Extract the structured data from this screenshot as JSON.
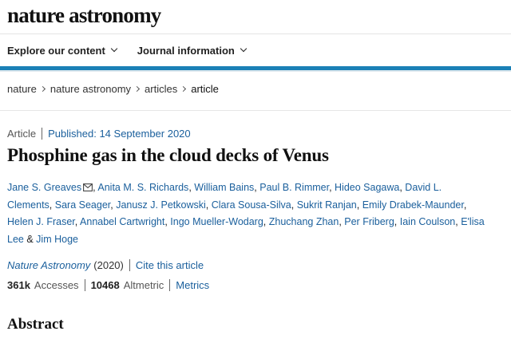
{
  "header": {
    "brand": "nature astronomy"
  },
  "nav": {
    "items": [
      {
        "label": "Explore our content"
      },
      {
        "label": "Journal information"
      }
    ]
  },
  "breadcrumb": [
    "nature",
    "nature astronomy",
    "articles",
    "article"
  ],
  "article": {
    "type": "Article",
    "published": "Published: 14 September 2020",
    "title": "Phosphine gas in the cloud decks of Venus",
    "authors": [
      "Jane S. Greaves",
      "Anita M. S. Richards",
      "William Bains",
      "Paul B. Rimmer",
      "Hideo Sagawa",
      "David L. Clements",
      "Sara Seager",
      "Janusz J. Petkowski",
      "Clara Sousa-Silva",
      "Sukrit Ranjan",
      "Emily Drabek-Maunder",
      "Helen J. Fraser",
      "Annabel Cartwright",
      "Ingo Mueller-Wodarg",
      "Zhuchang Zhan",
      "Per Friberg",
      "Iain Coulson",
      "E'lisa Lee",
      "Jim Hoge"
    ],
    "author_conjunction": "&",
    "journal": "Nature Astronomy",
    "year": "(2020)",
    "cite_label": "Cite this article",
    "accesses_value": "361k",
    "accesses_label": "Accesses",
    "altmetric_value": "10468",
    "altmetric_label": "Altmetric",
    "metrics_label": "Metrics"
  },
  "abstract": {
    "heading": "Abstract"
  },
  "colors": {
    "accent_bar": "#1a80b6",
    "link": "#1a5f9c"
  }
}
